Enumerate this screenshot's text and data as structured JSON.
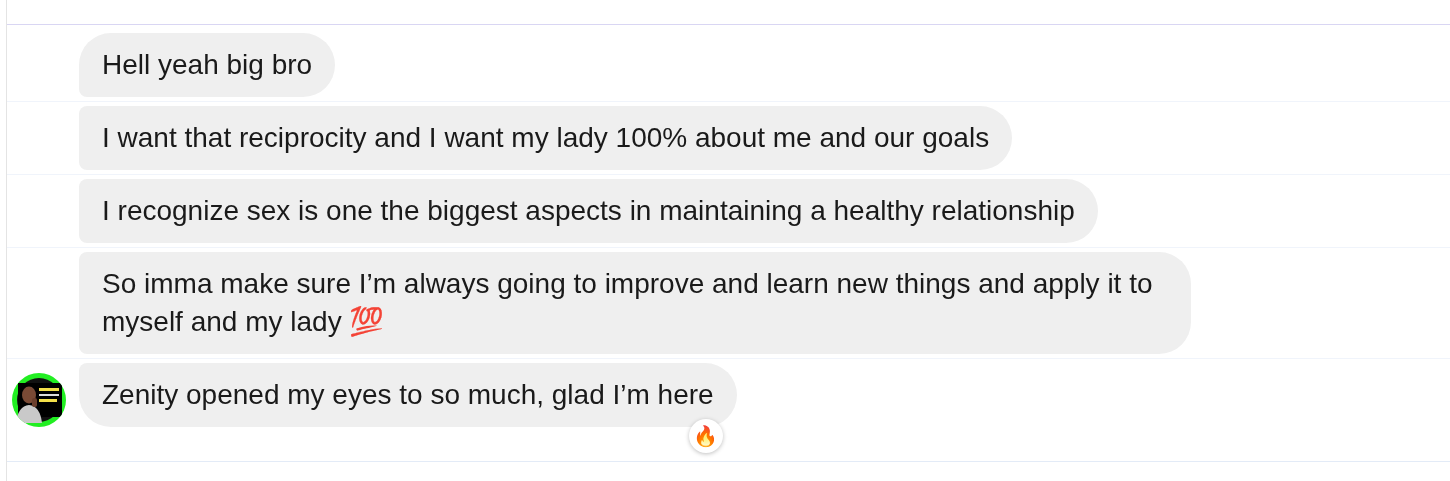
{
  "messages": [
    {
      "text": "Hell yeah big bro",
      "avatar": false
    },
    {
      "text": "I want that reciprocity and I want my lady 100% about me and our goals",
      "avatar": false
    },
    {
      "text": "I recognize sex is one the biggest aspects in maintaining a healthy relationship",
      "avatar": false
    },
    {
      "text": "So imma make sure I’m always going to improve and learn new things and apply it to myself and my lady 💯",
      "avatar": false
    },
    {
      "text": "Zenity opened my eyes to so much, glad I’m here",
      "avatar": true,
      "reaction": "🔥"
    }
  ]
}
